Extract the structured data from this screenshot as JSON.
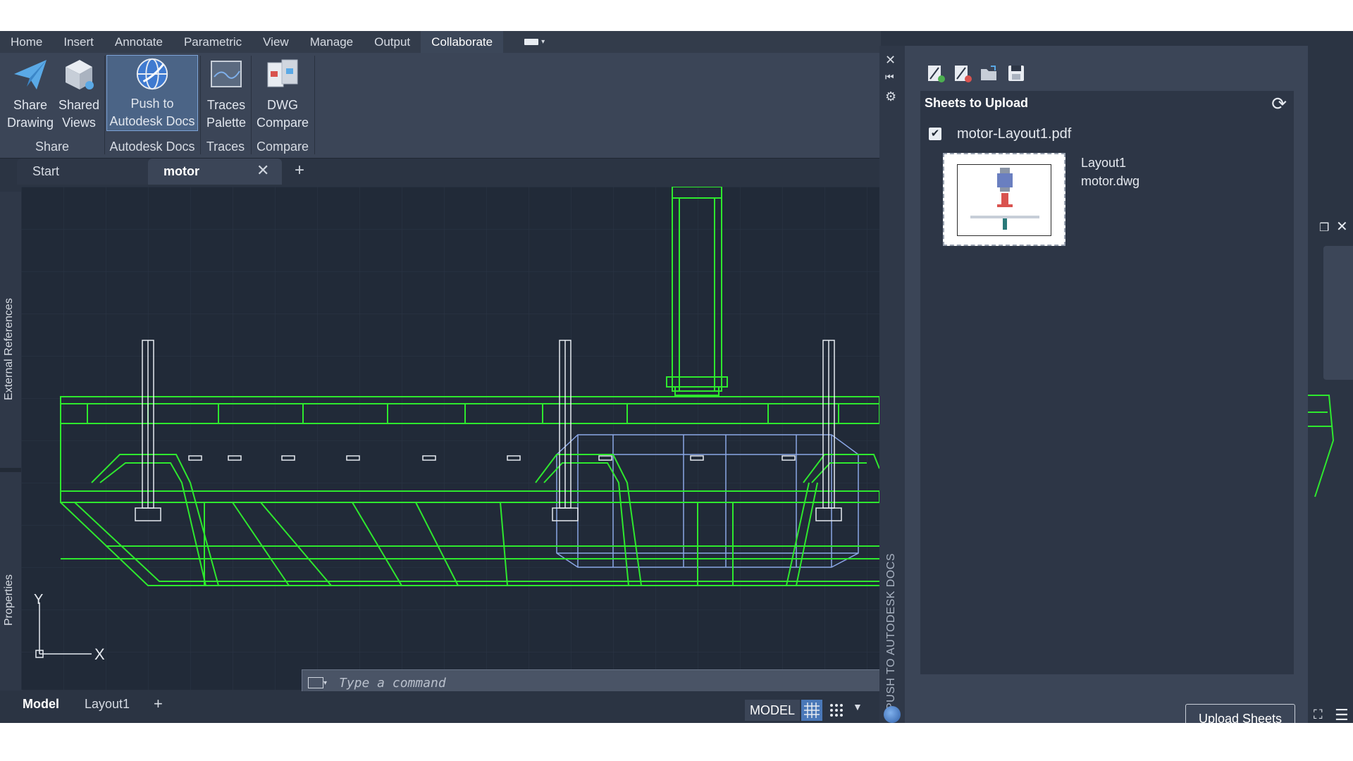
{
  "ribbon_tabs": [
    "Home",
    "Insert",
    "Annotate",
    "Parametric",
    "View",
    "Manage",
    "Output",
    "Collaborate"
  ],
  "ribbon": {
    "share_drawing": [
      "Share",
      "Drawing"
    ],
    "shared_views": [
      "Shared",
      "Views"
    ],
    "push_docs": [
      "Push to",
      "Autodesk Docs"
    ],
    "traces_palette": [
      "Traces",
      "Palette"
    ],
    "dwg_compare": [
      "DWG",
      "Compare"
    ],
    "group_share": "Share",
    "group_docs": "Autodesk Docs",
    "group_traces": "Traces",
    "group_compare": "Compare"
  },
  "doc_tabs": {
    "start": "Start",
    "motor": "motor"
  },
  "left_palettes": {
    "xref": "External References",
    "props": "Properties"
  },
  "ucs": {
    "y": "Y",
    "x": "X"
  },
  "command": {
    "placeholder": "Type a command"
  },
  "status": {
    "model_tab": "Model",
    "layout_tab": "Layout1",
    "model_button": "MODEL"
  },
  "palette": {
    "title": "PUSH TO AUTODESK DOCS",
    "sheets_header": "Sheets to Upload",
    "sheet": {
      "filename": "motor-Layout1.pdf",
      "layout": "Layout1",
      "dwg": "motor.dwg",
      "checked": true
    },
    "upload_button": "Upload Sheets"
  },
  "colors": {
    "accent": "#4b6486",
    "wire_green": "#2ee82e",
    "wire_blue": "#8ba7e6",
    "canvas_bg": "#212a38"
  },
  "icons": [
    "paper-plane-icon",
    "shared-views-icon",
    "autodesk-docs-icon",
    "traces-icon",
    "dwg-compare-icon",
    "refresh-icon",
    "close-icon",
    "gear-icon",
    "wrench-icon",
    "globe-icon"
  ]
}
